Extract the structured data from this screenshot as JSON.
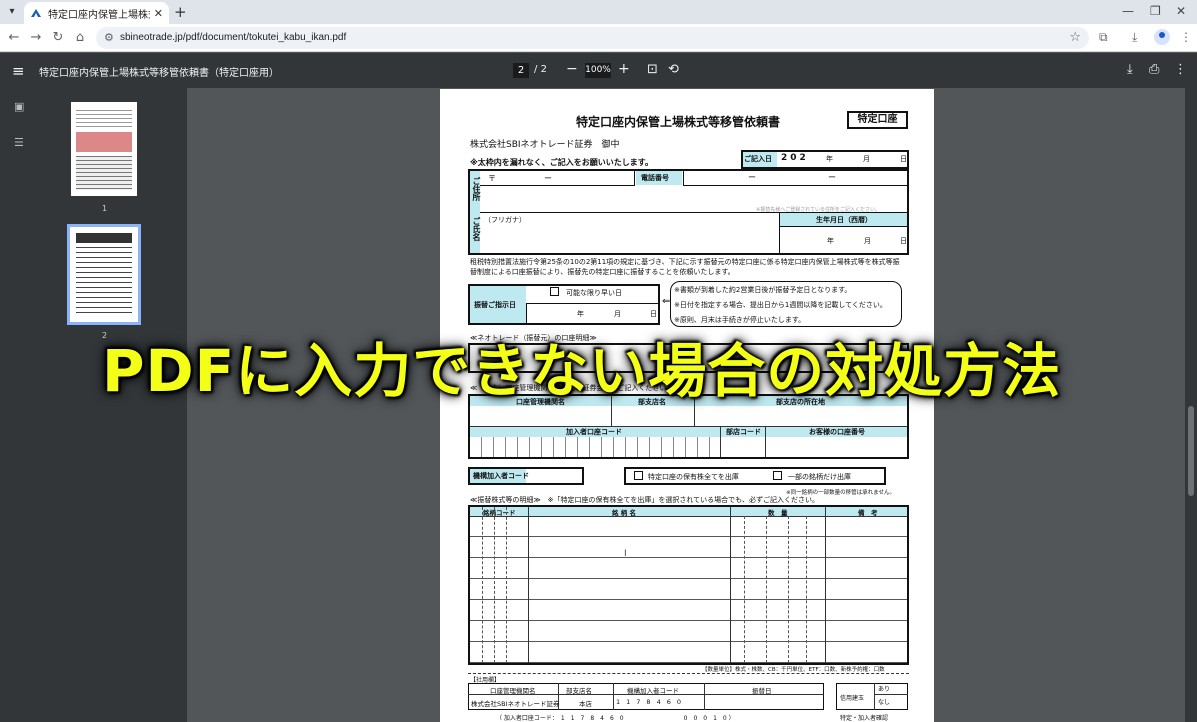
{
  "browser": {
    "tab_title": "特定口座内保管上場株式等移管",
    "url": "sbineotrade.jp/pdf/document/tokutei_kabu_ikan.pdf"
  },
  "pdf": {
    "title": "特定口座内保管上場株式等移管依頼書（特定口座用）",
    "current_page": "2",
    "page_separator": "/",
    "total_pages": "2",
    "zoom": "100%",
    "thumbnails": [
      "1",
      "2"
    ]
  },
  "form": {
    "title": "特定口座内保管上場株式等移管依頼書",
    "badge": "特定口座",
    "addressee": "株式会社SBIネオトレード証券　御中",
    "instruction": "※太枠内を漏れなく、ご記入をお願いいたします。",
    "date_label": "ご記入日",
    "year_prefix": [
      "2",
      "0",
      "2"
    ],
    "year": "年",
    "month": "月",
    "day": "日",
    "postal_mark": "〒",
    "dash": "ー",
    "address_label": "ご住所",
    "phone_label": "電話番号",
    "address_note": "※振替先様へご登録されている住所をご記入ください。",
    "furigana": "（フリガナ）",
    "name_label": "ご氏名",
    "birth_label": "生年月日（西暦）",
    "paragraph": "租税特別措置法施行令第25条の10の2第11項の規定に基づき、下記に示す振替元の特定口座に係る特定口座内保管上場株式等を株式等振替制度による口座振替により、振替先の特定口座に振替することを依頼いたします。",
    "transfer_date_label": "振替ご指示日",
    "asap": "可能な限り早い日",
    "notes": [
      "※書類が到着した約2営業日後が振替予定日となります。",
      "※日付を指定する場合、提出日から1週間以降を記載してください。",
      "※原則、月末は手続きが停止いたします。"
    ],
    "from_heading": "≪ネオトレード（振替元）の口座明細≫",
    "to_heading": "≪（受方）口座管理機関（移管先の証券会社へご記入ください）≫",
    "to_org": "口座管理機関名",
    "to_branch": "部支店名",
    "to_branch_addr": "部支店の所在地",
    "participant_code": "加入者口座コード",
    "branch_code": "部店コード",
    "account_no": "お客様の口座番号",
    "org_code_label": "機構加入者コード",
    "opt_all": "特定口座の保有株全てを出庫",
    "opt_partial": "一部の銘柄だけ出庫",
    "partial_note": "※同一銘柄の一部数量の移管は承れません。",
    "details_heading": "≪振替株式等の明細≫　※「特定口座の保有株全てを出庫」を選択されている場合でも、必ずご記入ください。",
    "col_code": "銘柄コード",
    "col_name": "銘 柄 名",
    "col_qty": "数　量",
    "col_note": "備　考",
    "footnote": "【数量単位】株式・株数、CB：千円単位、ETF：口数、新株予約権：口数",
    "office_label": "【社用欄】",
    "office_cols": [
      "口座管理機関名",
      "部支店名",
      "機構加入者コード",
      "振替日"
    ],
    "office_org": "株式会社SBIネオトレード証券",
    "office_branch": "本店",
    "office_code": [
      "1",
      "1",
      "7",
      "8",
      "4",
      "6",
      "0"
    ],
    "credit": "信用建玉",
    "credit_yes": "あり",
    "credit_no": "なし",
    "confirm": "特定・加入者確認",
    "bottom_line": "（ 加入者口座コード：　1　1　7　8　4　6　0　　　　　　　　　　0　0　0　1　0 ）"
  },
  "overlay_caption": "PDFに入力できない場合の対処方法",
  "colors": {
    "caption": "#f3ff17",
    "form_cyan": "#bfe9f0",
    "viewer_bg": "#525659",
    "toolbar_bg": "#323639"
  }
}
